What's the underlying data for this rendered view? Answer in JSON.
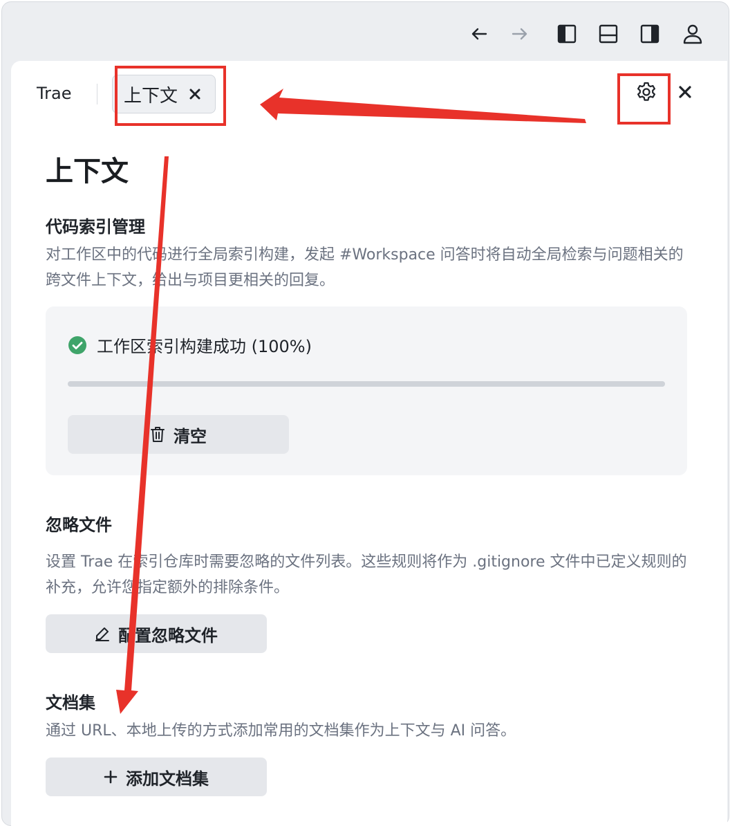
{
  "window_toolbar": {
    "buttons": [
      "back-arrow-icon",
      "forward-arrow-icon",
      "toggle-left-sidebar-icon",
      "toggle-bottom-panel-icon",
      "toggle-right-sidebar-icon",
      "account-icon"
    ]
  },
  "tabs": {
    "trae": "Trae",
    "active": "上下文"
  },
  "page": {
    "title": "上下文"
  },
  "code_index": {
    "heading": "代码索引管理",
    "description": "对工作区中的代码进行全局索引构建，发起 #Workspace 问答时将自动全局检索与问题相关的跨文件上下文，给出与项目更相关的回复。",
    "status": "工作区索引构建成功 (100%)",
    "progress": 1.0,
    "clear_label": "清空"
  },
  "ignore_files": {
    "heading": "忽略文件",
    "description": "设置 Trae 在索引仓库时需要忽略的文件列表。这些规则将作为 .gitignore 文件中已定义规则的补充，允许您指定额外的排除条件。",
    "button_label": "配置忽略文件"
  },
  "docs": {
    "heading": "文档集",
    "description": "通过 URL、本地上传的方式添加常用的文档集作为上下文与 AI 问答。",
    "button_label": "添加文档集"
  },
  "colors": {
    "accent_green": "#3fa46a",
    "annotation_red": "#e8322a"
  }
}
